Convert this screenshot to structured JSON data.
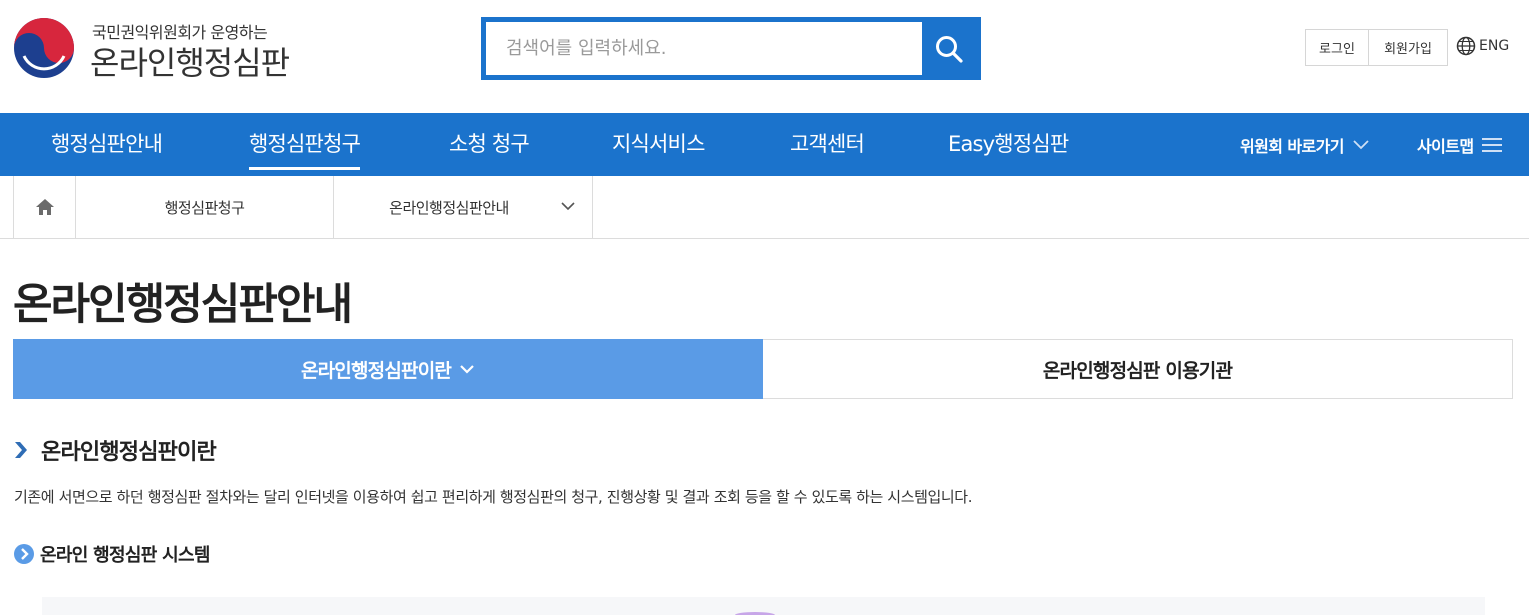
{
  "header": {
    "top_notice": "",
    "logo": {
      "subtitle": "국민권익위원회가 운영하는",
      "title": "온라인행정심판"
    },
    "search": {
      "placeholder": "검색어를 입력하세요.",
      "button_icon": "search-icon"
    },
    "utility": {
      "login": "로그인",
      "join": "회원가입",
      "language": "ENG",
      "language_icon": "globe-icon"
    }
  },
  "gnb": {
    "items": [
      {
        "label": "행정심판안내",
        "active": false
      },
      {
        "label": "행정심판청구",
        "active": true
      },
      {
        "label": "소청 청구",
        "active": false
      },
      {
        "label": "지식서비스",
        "active": false
      },
      {
        "label": "고객센터",
        "active": false
      },
      {
        "label": "Easy행정심판",
        "active": false
      }
    ],
    "committee_shortcut": "위원회 바로가기",
    "sitemap": "사이트맵"
  },
  "breadcrumb": {
    "home_icon": "home-icon",
    "level1": "행정심판청구",
    "level2": "온라인행정심판안내"
  },
  "page": {
    "title": "온라인행정심판안내",
    "tabs": [
      {
        "label": "온라인행정심판이란",
        "active": true
      },
      {
        "label": "온라인행정심판 이용기관",
        "active": false
      }
    ],
    "section": {
      "title": "온라인행정심판이란",
      "description": "기존에 서면으로 하던 행정심판 절차와는 달리 인터넷을 이용하여 쉽고 편리하게 행정심판의 청구, 진행상황 및 결과 조회 등을 할 수 있도록 하는 시스템입니다."
    },
    "subsection": {
      "title": "온라인 행정심판 시스템"
    }
  },
  "colors": {
    "primary": "#1b73cc",
    "tab_active": "#5a9be6",
    "logo_red": "#d7263d",
    "logo_blue": "#1d3f8f"
  }
}
